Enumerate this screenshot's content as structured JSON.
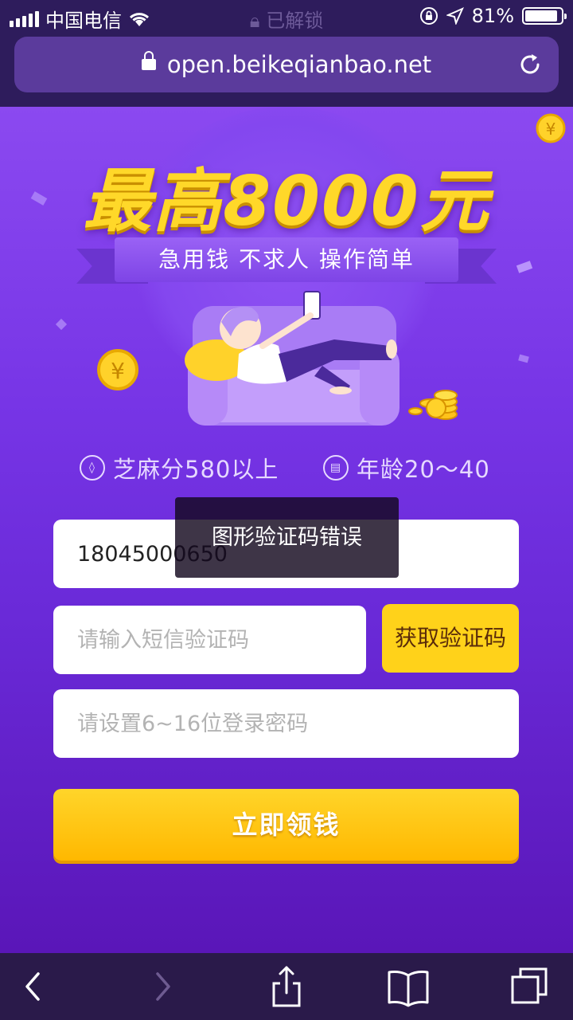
{
  "status_bar": {
    "carrier": "中国电信",
    "center_text": "已解锁",
    "battery": "81%"
  },
  "browser": {
    "url": "open.beikeqianbao.net"
  },
  "hero": {
    "headline": "最高8000元",
    "tagline": "急用钱 不求人 操作简单"
  },
  "conditions": {
    "credit": "芝麻分580以上",
    "age": "年龄20～40"
  },
  "form": {
    "phone_value": "18045000650",
    "sms_placeholder": "请输入短信验证码",
    "get_code_label": "获取验证码",
    "password_placeholder": "请设置6~16位登录密码",
    "submit_label": "立即领钱"
  },
  "toast": {
    "message": "图形验证码错误"
  },
  "colors": {
    "brand_purple": "#7a3be8",
    "accent_yellow": "#ffd21a",
    "browser_bar": "#2e1c5c"
  },
  "icons": [
    "signal-icon",
    "wifi-icon",
    "lock-icon",
    "location-icon",
    "battery-icon",
    "reload-icon",
    "back-icon",
    "forward-icon",
    "share-icon",
    "bookmarks-icon",
    "tabs-icon",
    "coin-icon",
    "sesame-icon",
    "age-icon"
  ]
}
